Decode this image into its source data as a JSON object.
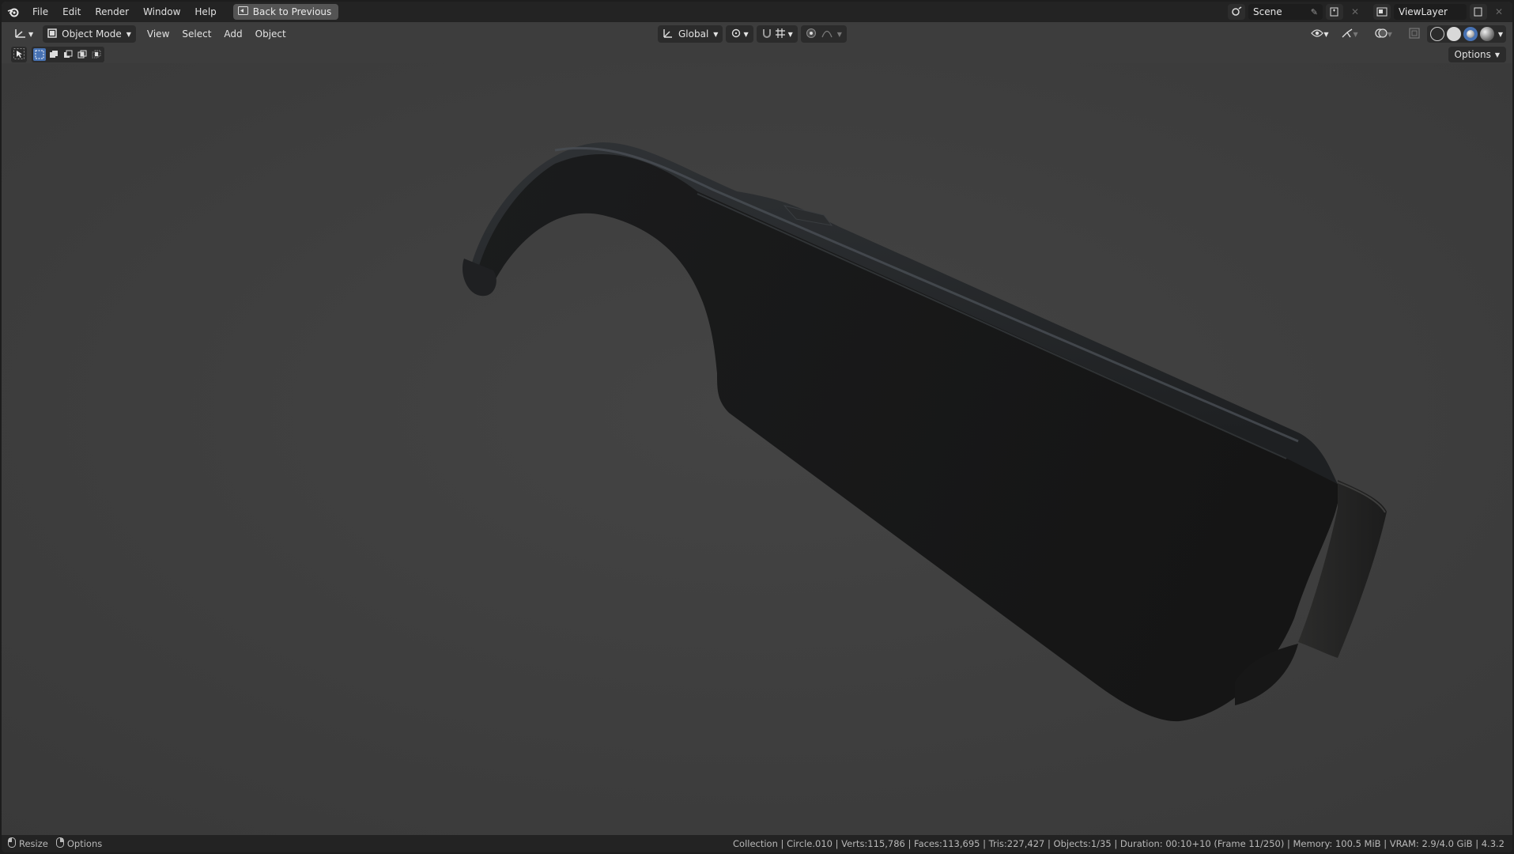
{
  "menubar": {
    "items": [
      "File",
      "Edit",
      "Render",
      "Window",
      "Help"
    ],
    "back_button": "Back to Previous"
  },
  "top_right": {
    "scene": "Scene",
    "view_layer": "ViewLayer"
  },
  "header": {
    "mode": "Object Mode",
    "menus": [
      "View",
      "Select",
      "Add",
      "Object"
    ],
    "orientation": "Global"
  },
  "viewport": {
    "options_label": "Options",
    "colors": {
      "background": "#3d3d3d",
      "object": "#1e1e1e",
      "accent": "#4772b3"
    }
  },
  "statusbar": {
    "left": [
      "Resize",
      "Options"
    ],
    "right": "Collection | Circle.010 | Verts:115,786 | Faces:113,695 | Tris:227,427 | Objects:1/35 | Duration: 00:10+10 (Frame 11/250) | Memory: 100.5 MiB | VRAM: 2.9/4.0 GiB | 4.3.2"
  }
}
